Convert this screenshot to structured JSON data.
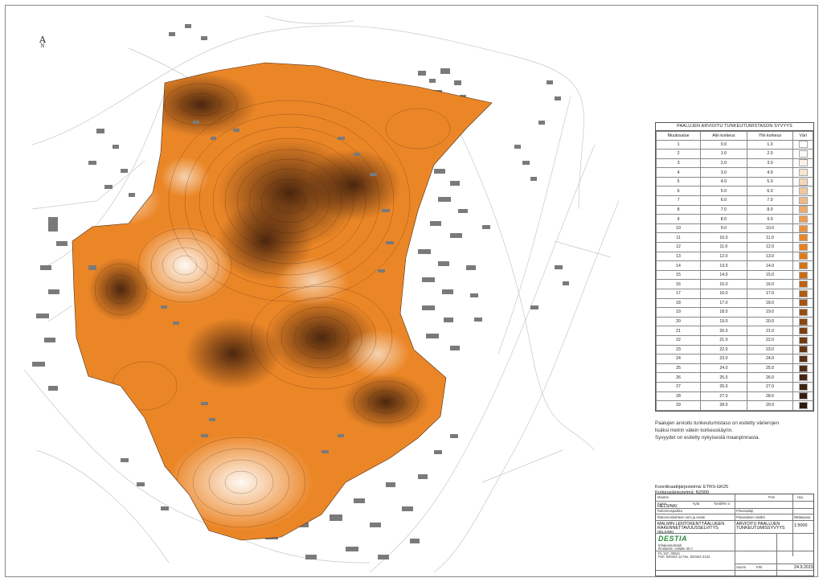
{
  "north_arrow": {
    "glyph": "A",
    "label": "N"
  },
  "legend": {
    "title": "PAALUJEN ARVIOITU TUNKEUTUMISTASON SYVYYS",
    "headers": [
      "Muutosalue",
      "Alin korkeus",
      "Ylin korkeus",
      "Väri"
    ],
    "rows": [
      {
        "id": "1",
        "low": "0.0",
        "high": "1.0",
        "color": "#ffffff"
      },
      {
        "id": "2",
        "low": "1.0",
        "high": "2.0",
        "color": "#fefaf6"
      },
      {
        "id": "3",
        "low": "2.0",
        "high": "3.0",
        "color": "#fcf1e6"
      },
      {
        "id": "4",
        "low": "3.0",
        "high": "4.0",
        "color": "#f9e4d0"
      },
      {
        "id": "5",
        "low": "4.0",
        "high": "5.0",
        "color": "#f6d6b7"
      },
      {
        "id": "6",
        "low": "5.0",
        "high": "6.0",
        "color": "#f3c79d"
      },
      {
        "id": "7",
        "low": "6.0",
        "high": "7.0",
        "color": "#f1b983"
      },
      {
        "id": "8",
        "low": "7.0",
        "high": "8.0",
        "color": "#efaa69"
      },
      {
        "id": "9",
        "low": "8.0",
        "high": "9.0",
        "color": "#ed9c50"
      },
      {
        "id": "10",
        "low": "9.0",
        "high": "10.0",
        "color": "#ec9039"
      },
      {
        "id": "11",
        "low": "10.0",
        "high": "11.0",
        "color": "#eb8627"
      },
      {
        "id": "12",
        "low": "11.0",
        "high": "12.0",
        "color": "#e8801c"
      },
      {
        "id": "13",
        "low": "12.0",
        "high": "13.0",
        "color": "#e27a15"
      },
      {
        "id": "14",
        "low": "13.0",
        "high": "14.0",
        "color": "#d97312"
      },
      {
        "id": "15",
        "low": "14.0",
        "high": "15.0",
        "color": "#cd6b10"
      },
      {
        "id": "16",
        "low": "15.0",
        "high": "16.0",
        "color": "#c0630f"
      },
      {
        "id": "17",
        "low": "16.0",
        "high": "17.0",
        "color": "#b35b0f"
      },
      {
        "id": "18",
        "low": "17.0",
        "high": "18.0",
        "color": "#a6540f"
      },
      {
        "id": "19",
        "low": "18.0",
        "high": "19.0",
        "color": "#984d10"
      },
      {
        "id": "20",
        "low": "19.0",
        "high": "20.0",
        "color": "#8b4611"
      },
      {
        "id": "21",
        "low": "20.0",
        "high": "21.0",
        "color": "#7e4012"
      },
      {
        "id": "22",
        "low": "21.0",
        "high": "22.0",
        "color": "#723a13"
      },
      {
        "id": "23",
        "low": "22.0",
        "high": "23.0",
        "color": "#663413"
      },
      {
        "id": "24",
        "low": "23.0",
        "high": "24.0",
        "color": "#5b2f13"
      },
      {
        "id": "25",
        "low": "24.0",
        "high": "25.0",
        "color": "#512a13"
      },
      {
        "id": "26",
        "low": "25.0",
        "high": "26.0",
        "color": "#482613"
      },
      {
        "id": "27",
        "low": "26.0",
        "high": "27.0",
        "color": "#402212"
      },
      {
        "id": "28",
        "low": "27.0",
        "high": "28.0",
        "color": "#381e11"
      },
      {
        "id": "29",
        "low": "28.0",
        "high": "29.0",
        "color": "#301a10"
      }
    ]
  },
  "note": {
    "line1": "Paalujen arvioitu tunkeutumistaso on esitetty värierojen",
    "line2": "lisäksi metrin välein korkeuskäyrin.",
    "line3": "Syvyydet on esitetty nykyisestä maanpinnasta."
  },
  "coord_system": {
    "line1": "Koordinaattijärjestelmä: ETRS-GK25",
    "line2": "Korkeusjärjestelmä: N2000"
  },
  "title_block": {
    "muutos": "Muutos",
    "pvm": "Pvm",
    "hyv": "Hyv.",
    "kunta_label": "Kunta",
    "kunta": "HELSINKI",
    "kyla": "Kylä",
    "tontti": "Tontti/Rn o",
    "rakennuspaikka": "Rakennuspaikka",
    "osoite": "Rakennuskohteen nimi ja osoite",
    "piirustuslaji": "Piirustuslaji",
    "project_line1": "MALMIN LENTOKENTTÄALUEEN",
    "project_line2": "RAKENNETTAVUUSSELVITYS",
    "project_line3": "HELSINKI",
    "sisalto_label": "Piirustuksen sisältö",
    "sisalto_line1": "ARVIOITU PAALUJEN",
    "sisalto_line2": "TUNKEUTUMISSYVYYS",
    "mittakaava_label": "Mittakaava",
    "mittakaava": "1:5000",
    "company": "DESTIA",
    "company_line1": "Infrakonsultointi",
    "company_line2": "Ilmalantie, valtatie 30 A",
    "company_line3": "PL 157, 00521",
    "company_line4": "Puh. 020444 11  Fax. 020444 2134",
    "suunn": "Suunn",
    "piirt": "Piirt",
    "date": "24.9.2015"
  },
  "colors": {
    "orange": "#eb8627",
    "dark": "#5b2f13",
    "building": "#777777",
    "line": "#bdbdbd"
  }
}
